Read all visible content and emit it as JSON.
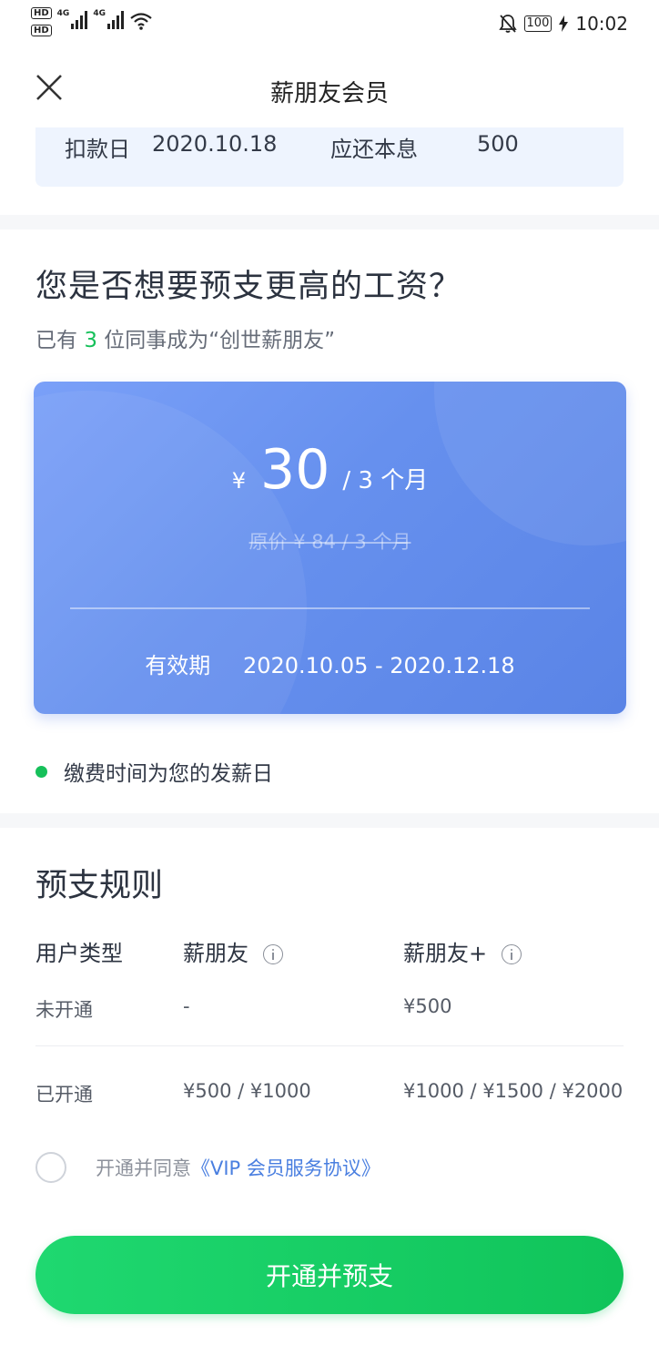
{
  "status_bar": {
    "hd1": "HD",
    "hd2": "HD",
    "net1": "4G",
    "net2": "4G",
    "battery": "100",
    "time": "10:02"
  },
  "header": {
    "title": "薪朋友会员"
  },
  "repayment": {
    "date_label": "扣款日",
    "date_value": "2020.10.18",
    "amount_label": "应还本息",
    "amount_value": "500"
  },
  "promo": {
    "title": "您是否想要预支更高的工资？",
    "sub_prefix": "已有",
    "sub_count": "3",
    "sub_suffix": "位同事成为“创世薪朋友”"
  },
  "card": {
    "currency": "¥",
    "price": "30",
    "period": "/ 3 个月",
    "original": "原价 ¥ 84 / 3 个月",
    "validity_label": "有效期",
    "validity_range": "2020.10.05 - 2020.12.18"
  },
  "note": "缴费时间为您的发薪日",
  "rules": {
    "title": "预支规则",
    "headers": [
      "用户类型",
      "薪朋友",
      "薪朋友+"
    ],
    "rows": [
      [
        "未开通",
        "-",
        "¥500"
      ],
      [
        "已开通",
        "¥500 / ¥1000",
        "¥1000 / ¥1500 / ¥2000"
      ]
    ]
  },
  "agreement": {
    "prefix": "开通并同意",
    "link": "《VIP 会员服务协议》"
  },
  "cta_label": "开通并预支",
  "colors": {
    "brand_green": "#16c05a",
    "card_blue": "#6690ee",
    "link_blue": "#4a7fe0"
  }
}
